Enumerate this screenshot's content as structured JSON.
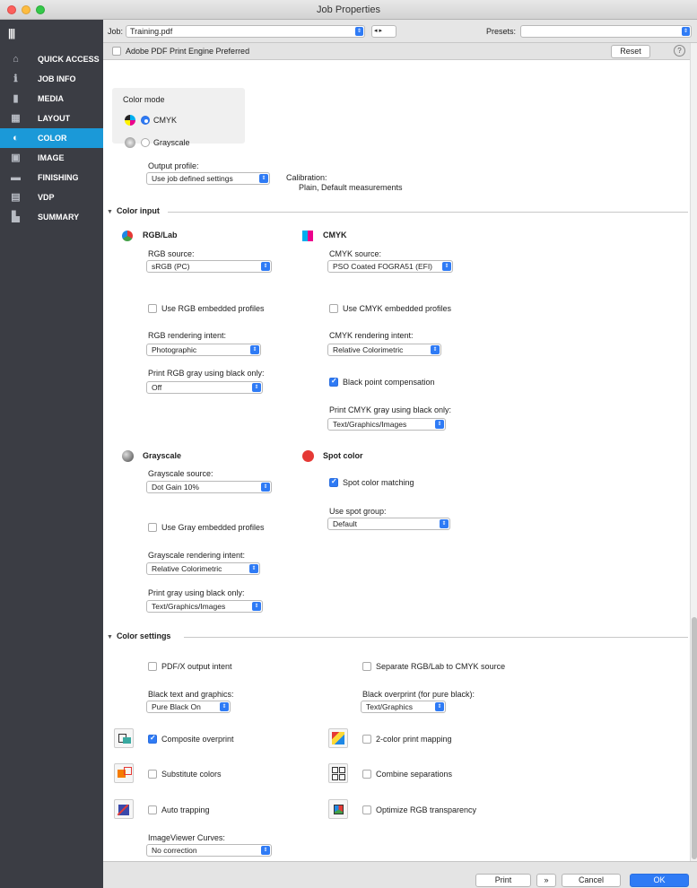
{
  "window": {
    "title": "Job Properties"
  },
  "sidebar": {
    "items": [
      {
        "label": "QUICK ACCESS",
        "icon": "home-icon",
        "glyph": "⌂"
      },
      {
        "label": "JOB INFO",
        "icon": "info-icon",
        "glyph": "ℹ"
      },
      {
        "label": "MEDIA",
        "icon": "media-icon",
        "glyph": "▮"
      },
      {
        "label": "LAYOUT",
        "icon": "layout-icon",
        "glyph": "▦"
      },
      {
        "label": "COLOR",
        "icon": "color-icon",
        "glyph": "◐"
      },
      {
        "label": "IMAGE",
        "icon": "image-icon",
        "glyph": "▣"
      },
      {
        "label": "FINISHING",
        "icon": "finishing-icon",
        "glyph": "▬"
      },
      {
        "label": "VDP",
        "icon": "vdp-icon",
        "glyph": "▤"
      },
      {
        "label": "SUMMARY",
        "icon": "summary-icon",
        "glyph": "▙"
      }
    ],
    "active": "COLOR"
  },
  "jobbar": {
    "job_label": "Job:",
    "job_value": "Training.pdf",
    "presets_label": "Presets:",
    "presets_value": ""
  },
  "resetbar": {
    "pdf_engine_label": "Adobe PDF Print Engine Preferred",
    "reset_label": "Reset",
    "help_glyph": "?"
  },
  "color_mode": {
    "label": "Color mode",
    "cmyk": "CMYK",
    "grayscale": "Grayscale",
    "selected": "CMYK"
  },
  "output": {
    "label": "Output profile:",
    "value": "Use job defined settings",
    "calibration_label": "Calibration:",
    "calibration_value": "Plain, Default measurements"
  },
  "color_input": {
    "header": "Color input",
    "rgb": {
      "title": "RGB/Lab",
      "source_label": "RGB source:",
      "source_value": "sRGB (PC)",
      "embedded_label": "Use RGB embedded profiles",
      "intent_label": "RGB rendering intent:",
      "intent_value": "Photographic",
      "gray_label": "Print RGB gray using black only:",
      "gray_value": "Off"
    },
    "cmyk": {
      "title": "CMYK",
      "source_label": "CMYK source:",
      "source_value": "PSO Coated FOGRA51 (EFI)",
      "embedded_label": "Use CMYK embedded profiles",
      "intent_label": "CMYK rendering intent:",
      "intent_value": "Relative Colorimetric",
      "bpc_label": "Black point compensation",
      "gray_label": "Print CMYK gray using black only:",
      "gray_value": "Text/Graphics/Images"
    },
    "grayscale": {
      "title": "Grayscale",
      "source_label": "Grayscale source:",
      "source_value": "Dot Gain 10%",
      "embedded_label": "Use Gray embedded profiles",
      "intent_label": "Grayscale rendering intent:",
      "intent_value": "Relative Colorimetric",
      "gray_label": "Print gray using black only:",
      "gray_value": "Text/Graphics/Images"
    },
    "spot": {
      "title": "Spot color",
      "matching_label": "Spot color matching",
      "group_label": "Use spot group:",
      "group_value": "Default"
    }
  },
  "color_settings": {
    "header": "Color settings",
    "pdfx_label": "PDF/X output intent",
    "separate_label": "Separate RGB/Lab to CMYK source",
    "black_text_label": "Black text and graphics:",
    "black_text_value": "Pure Black On",
    "black_overprint_label": "Black overprint (for pure black):",
    "black_overprint_value": "Text/Graphics",
    "composite_label": "Composite overprint",
    "two_color_label": "2-color print mapping",
    "substitute_label": "Substitute colors",
    "combine_label": "Combine separations",
    "trapping_label": "Auto trapping",
    "optimize_label": "Optimize RGB transparency",
    "curves_label": "ImageViewer Curves:",
    "curves_value": "No correction"
  },
  "footer": {
    "print": "Print",
    "more": "»",
    "cancel": "Cancel",
    "ok": "OK"
  }
}
